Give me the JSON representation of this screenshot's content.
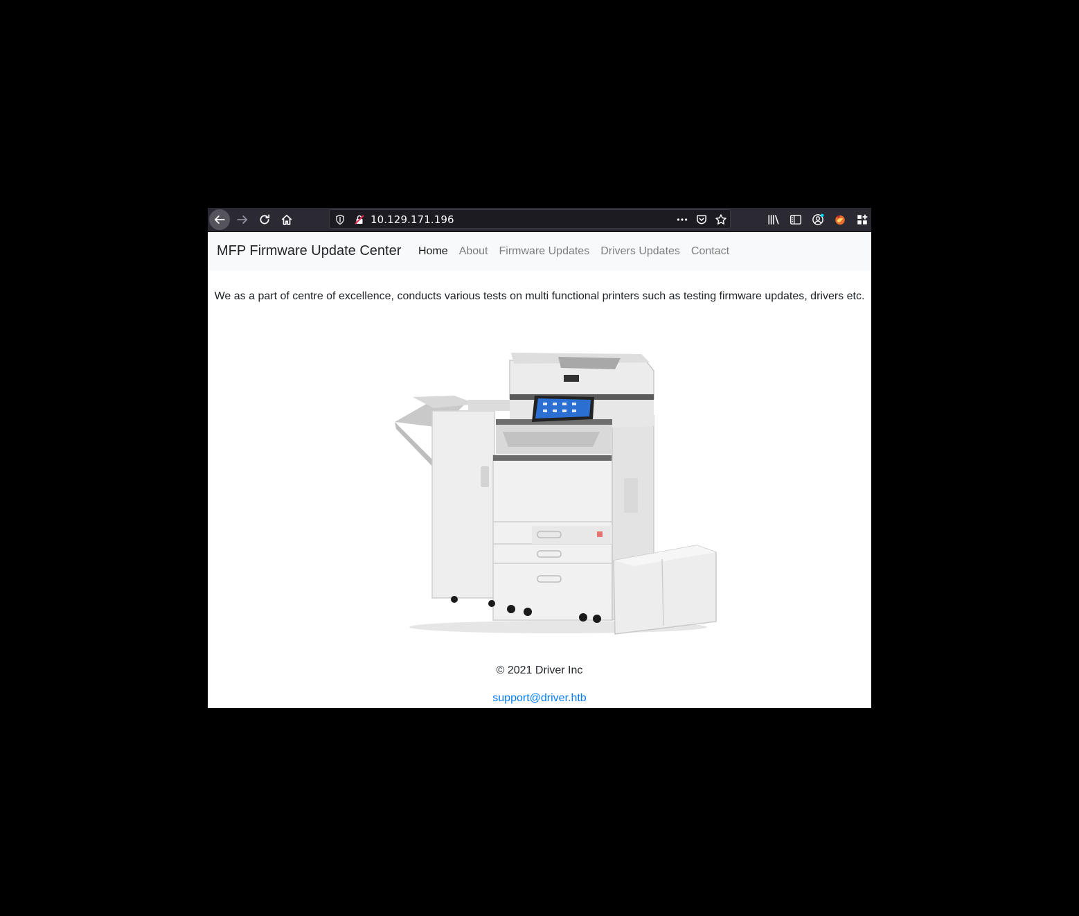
{
  "browser": {
    "url": "10.129.171.196",
    "colors": {
      "toolbar": "#2b2a33",
      "urlbar": "#1c1b22",
      "icon": "#fbfbfe"
    }
  },
  "site": {
    "brand": "MFP Firmware Update Center",
    "nav": [
      {
        "label": "Home",
        "active": true
      },
      {
        "label": "About",
        "active": false
      },
      {
        "label": "Firmware Updates",
        "active": false
      },
      {
        "label": "Drivers Updates",
        "active": false
      },
      {
        "label": "Contact",
        "active": false
      }
    ],
    "lead": "We as a part of centre of excellence, conducts various tests on multi functional printers such as testing firmware updates, drivers etc.",
    "footer": {
      "copyright": "© 2021 Driver Inc",
      "email": "support@driver.htb"
    },
    "colors": {
      "navbar_bg": "#f8f9fa",
      "text": "#212529",
      "link": "#007bff"
    }
  }
}
